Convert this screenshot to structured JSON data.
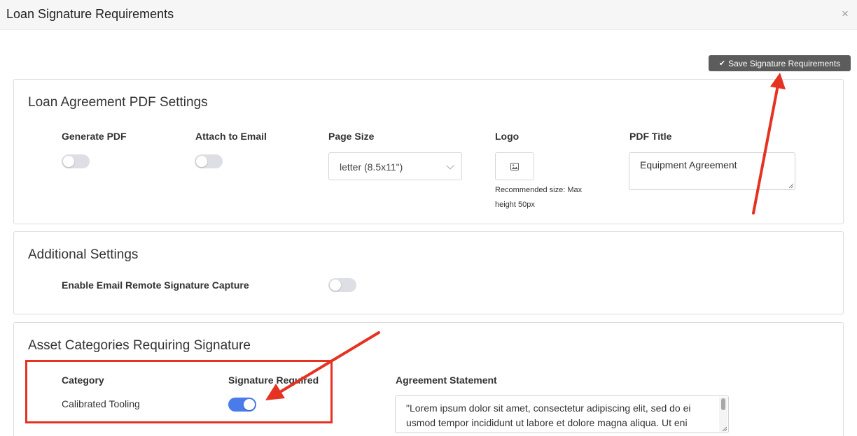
{
  "dialog": {
    "title": "Loan Signature Requirements",
    "close_icon": "×"
  },
  "toolbar": {
    "save_label": "Save Signature Requirements",
    "save_icon": "✔"
  },
  "pdf_settings": {
    "title": "Loan Agreement PDF Settings",
    "generate_pdf_label": "Generate PDF",
    "generate_pdf_on": false,
    "attach_email_label": "Attach to Email",
    "attach_email_on": false,
    "page_size_label": "Page Size",
    "page_size_value": "letter (8.5x11\")",
    "logo_label": "Logo",
    "logo_hint": "Recommended size: Max height 50px",
    "pdf_title_label": "PDF Title",
    "pdf_title_value": "Equipment Agreement"
  },
  "additional_settings": {
    "title": "Additional Settings",
    "remote_signature_label": "Enable Email Remote Signature Capture",
    "remote_signature_on": false
  },
  "asset_categories": {
    "title": "Asset Categories Requiring Signature",
    "col_category": "Category",
    "col_signature": "Signature Required",
    "col_statement": "Agreement Statement",
    "rows": [
      {
        "category": "Calibrated Tooling",
        "signature_required": true,
        "statement": "\"Lorem ipsum dolor sit amet, consectetur adipiscing elit, sed do ei usmod tempor incididunt ut labore et dolore magna aliqua. Ut eni"
      }
    ]
  },
  "colors": {
    "annotation": "#e53222",
    "toggle_on": "#4a7bea",
    "save_button": "#5c5c5c"
  }
}
